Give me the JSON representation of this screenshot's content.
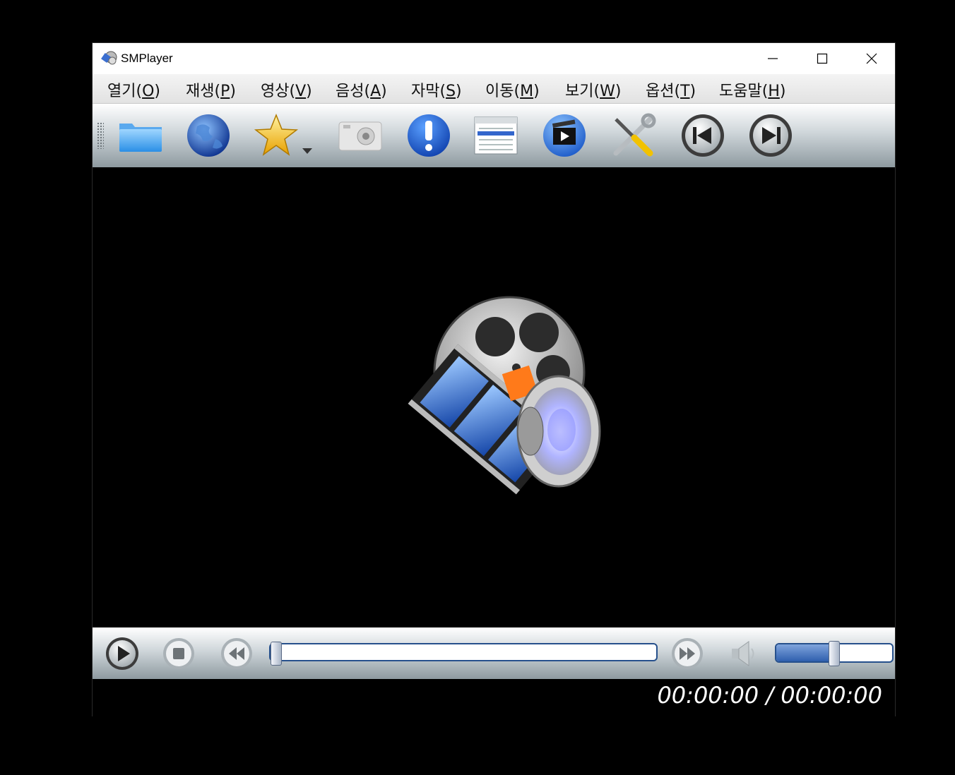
{
  "window": {
    "title": "SMPlayer"
  },
  "menu": [
    {
      "label": "열기(",
      "accel": "O",
      "tail": ")"
    },
    {
      "label": "재생(",
      "accel": "P",
      "tail": ")"
    },
    {
      "label": "영상(",
      "accel": "V",
      "tail": ")"
    },
    {
      "label": "음성(",
      "accel": "A",
      "tail": ")"
    },
    {
      "label": "자막(",
      "accel": "S",
      "tail": ")"
    },
    {
      "label": "이동(",
      "accel": "M",
      "tail": ")"
    },
    {
      "label": "보기(",
      "accel": "W",
      "tail": ")"
    },
    {
      "label": "옵션(",
      "accel": "T",
      "tail": ")"
    },
    {
      "label": "도움말(",
      "accel": "H",
      "tail": ")"
    }
  ],
  "toolbar": {
    "icons": [
      "folder-icon",
      "globe-icon",
      "favorites-star-icon",
      "screenshot-camera-icon",
      "info-icon",
      "playlist-icon",
      "video-preferences-icon",
      "tools-icon",
      "previous-icon",
      "next-icon"
    ]
  },
  "controls": {
    "icons": [
      "play-icon",
      "stop-icon",
      "rewind-icon",
      "forward-icon",
      "speaker-icon"
    ],
    "seek_position": 0,
    "volume_level": 0.5
  },
  "status": {
    "time": "00:00:00 / 00:00:00"
  },
  "colors": {
    "accent": "#26508c",
    "toolbar_top": "#ffffff",
    "toolbar_bottom": "#8e9aa0"
  }
}
